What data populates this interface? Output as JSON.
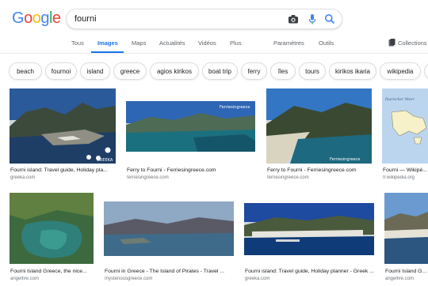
{
  "logo": {
    "letters": [
      "G",
      "o",
      "o",
      "g",
      "l",
      "e"
    ]
  },
  "search": {
    "query": "fourni"
  },
  "tabs": [
    {
      "label": "Tous"
    },
    {
      "label": "Images"
    },
    {
      "label": "Maps"
    },
    {
      "label": "Actualités"
    },
    {
      "label": "Vidéos"
    },
    {
      "label": "Plus"
    },
    {
      "label": "Paramètres"
    },
    {
      "label": "Outils"
    },
    {
      "label": "Collections"
    }
  ],
  "chips": [
    "beach",
    "fournoi",
    "island",
    "greece",
    "agios kirikos",
    "boat trip",
    "ferry",
    "îles",
    "tours",
    "kirikos ikaria",
    "wikipedia"
  ],
  "results": [
    {
      "title": "Fourni island: Travel guide, Holiday pla...",
      "source": "greeka.com"
    },
    {
      "title": "Ferry to Fourni - Ferriesingreece.com",
      "source": "ferriesingreece.com"
    },
    {
      "title": "Ferry to Fourni - Ferriesingreece.com",
      "source": "ferriesingreece.com"
    },
    {
      "title": "Fourni — Wikipé...",
      "source": "fr.wikipedia.org"
    },
    {
      "title": "Fourni Island Greece, the nice...",
      "source": "angelfire.com"
    },
    {
      "title": "Fourni in Greece - The Island of Pirates - Travel ...",
      "source": "mysteriousgreece.com"
    },
    {
      "title": "Fourni island: Travel guide, Holiday planner - Greek ...",
      "source": "greeka.com"
    },
    {
      "title": "Fourni Island Greece...",
      "source": "angelfire.com"
    }
  ],
  "watermarks": {
    "ferries_1": "Ferriesingreece",
    "ferries_2": "Ferriesingreece",
    "greeka": "GREEKA",
    "map": "Ikarischer Meer"
  },
  "colors": {
    "accent": "#1a73e8",
    "text": "#202124",
    "muted": "#70757a"
  },
  "icons": [
    "camera-icon",
    "microphone-icon",
    "search-icon",
    "collections-icon"
  ]
}
